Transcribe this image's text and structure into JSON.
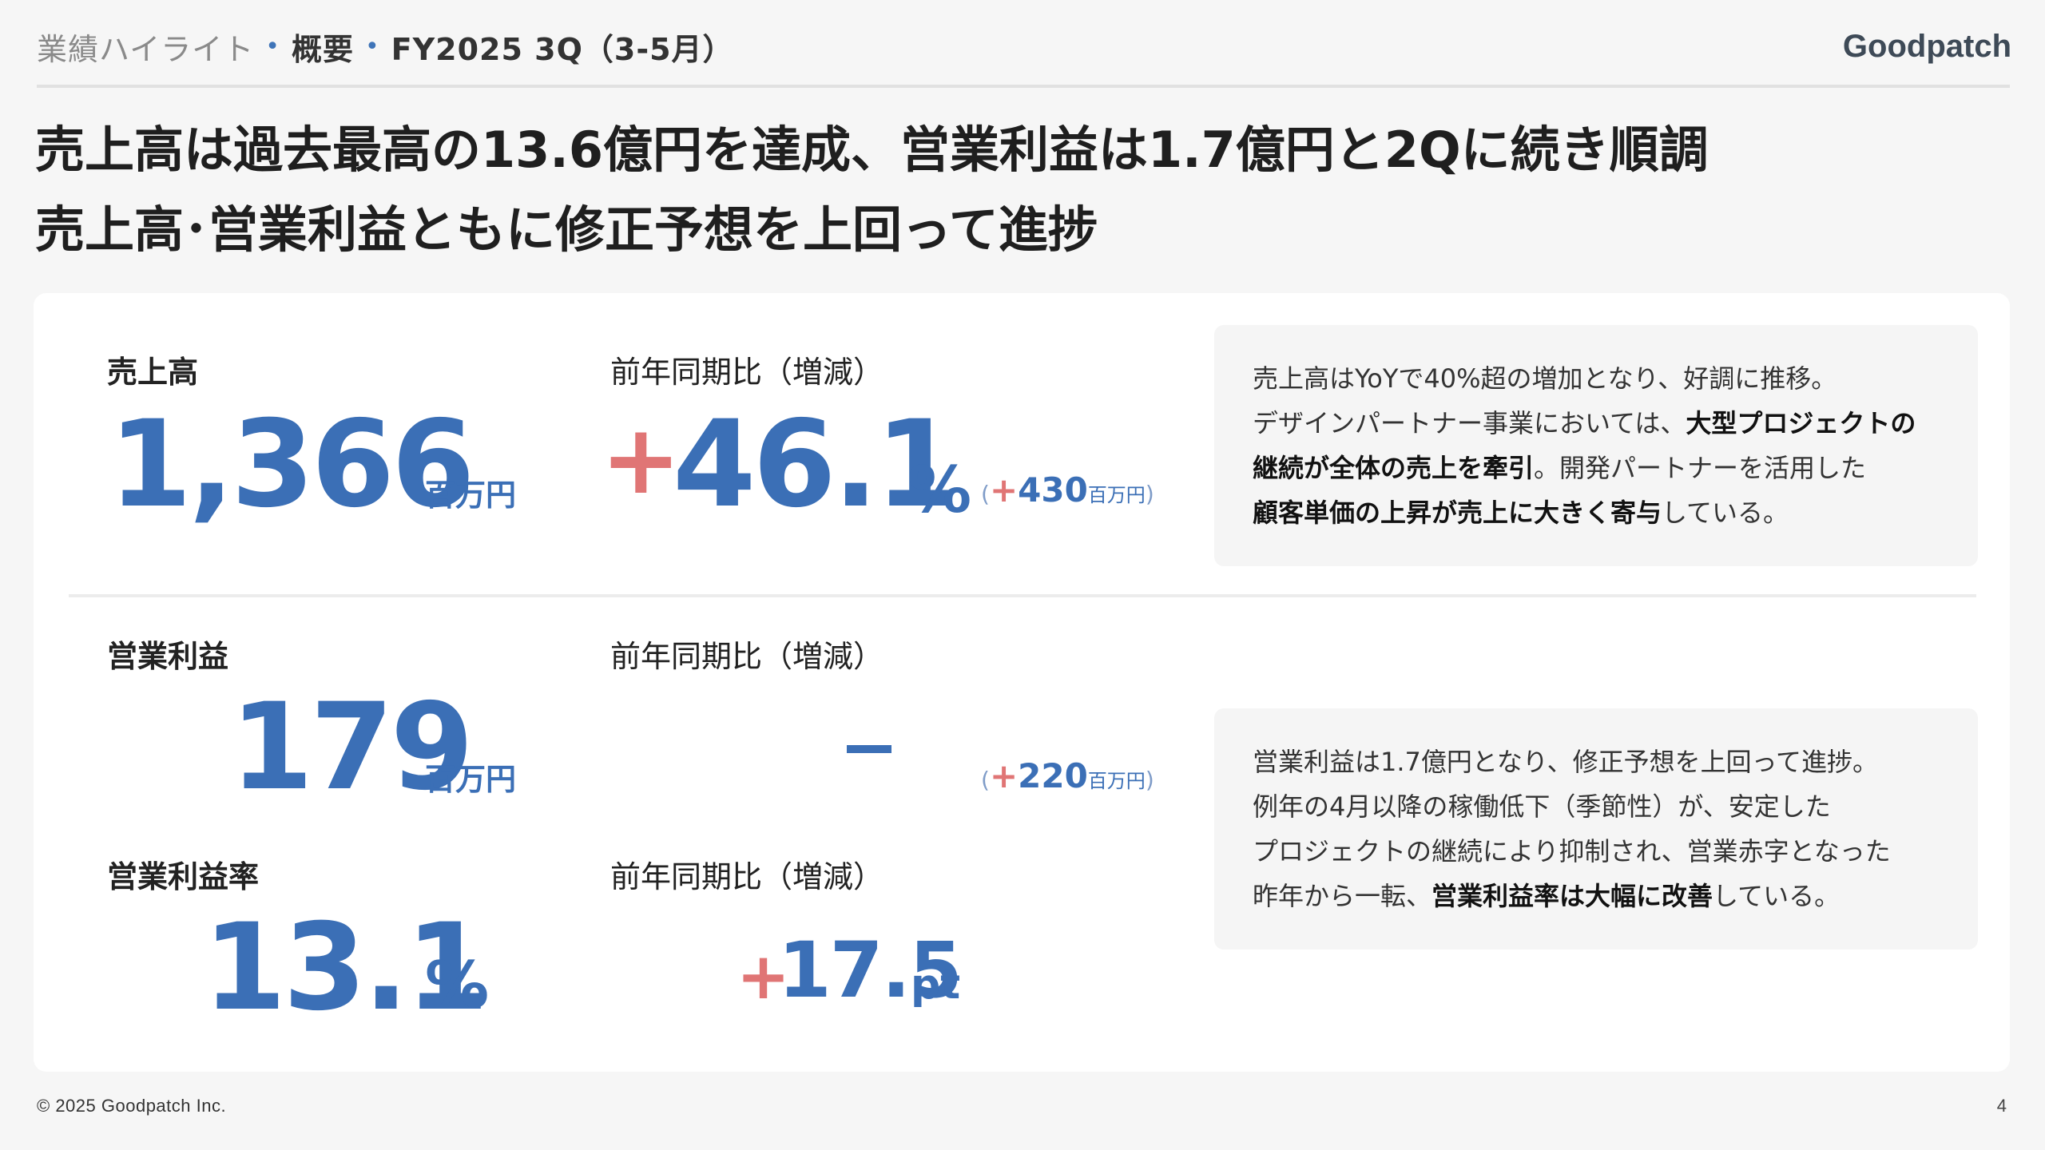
{
  "header": {
    "breadcrumb": [
      "業績ハイライト",
      "概要",
      "FY2025 3Q（3-5月）"
    ],
    "logo_text": "Goodpatch"
  },
  "headline": {
    "line1": "売上高は過去最高の13.6億円を達成、営業利益は1.7億円と2Qに続き順調",
    "line2": "売上高･営業利益ともに修正予想を上回って進捗"
  },
  "revenue": {
    "label": "売上高",
    "value": "1,366",
    "unit": "百万円",
    "yoy_label": "前年同期比（増減）",
    "yoy_sign": "+",
    "yoy_value": "46.1",
    "yoy_unit": "%",
    "yoy_diff_open": "(",
    "yoy_diff_sign": "+",
    "yoy_diff_value": "430",
    "yoy_diff_unit": "百万円",
    "yoy_diff_close": ")"
  },
  "operating_profit": {
    "label": "営業利益",
    "value": "179",
    "unit": "百万円",
    "yoy_label": "前年同期比（増減）",
    "yoy_value": "－",
    "yoy_diff_open": "(",
    "yoy_diff_sign": "+",
    "yoy_diff_value": "220",
    "yoy_diff_unit": "百万円",
    "yoy_diff_close": ")"
  },
  "operating_margin": {
    "label": "営業利益率",
    "value": "13.1",
    "unit": "%",
    "yoy_label": "前年同期比（増減）",
    "yoy_sign": "+",
    "yoy_value": "17.5",
    "yoy_unit": "pt"
  },
  "note_revenue": {
    "line1": "売上高はYoYで40%超の増加となり、好調に推移。",
    "line2_a": "デザインパートナー事業においては、",
    "line2_b": "大型プロジェクトの",
    "line3_a": "継続が全体の売上を牽引",
    "line3_b": "。開発パートナーを活用した",
    "line4_a": "顧客単価の上昇が売上に大きく寄与",
    "line4_b": "している。"
  },
  "note_profit": {
    "line1": "営業利益は1.7億円となり、修正予想を上回って進捗。",
    "line2": "例年の4月以降の稼働低下（季節性）が、安定した",
    "line3": "プロジェクトの継続により抑制され、営業赤字となった",
    "line4_a": "昨年から一転、",
    "line4_b": "営業利益率は大幅に改善",
    "line4_c": "している。"
  },
  "footer": {
    "copyright": "© 2025 Goodpatch Inc.",
    "page_number": "4"
  },
  "colors": {
    "accent_blue": "#3b6fb6",
    "accent_red": "#e07575",
    "background": "#f6f6f6"
  }
}
